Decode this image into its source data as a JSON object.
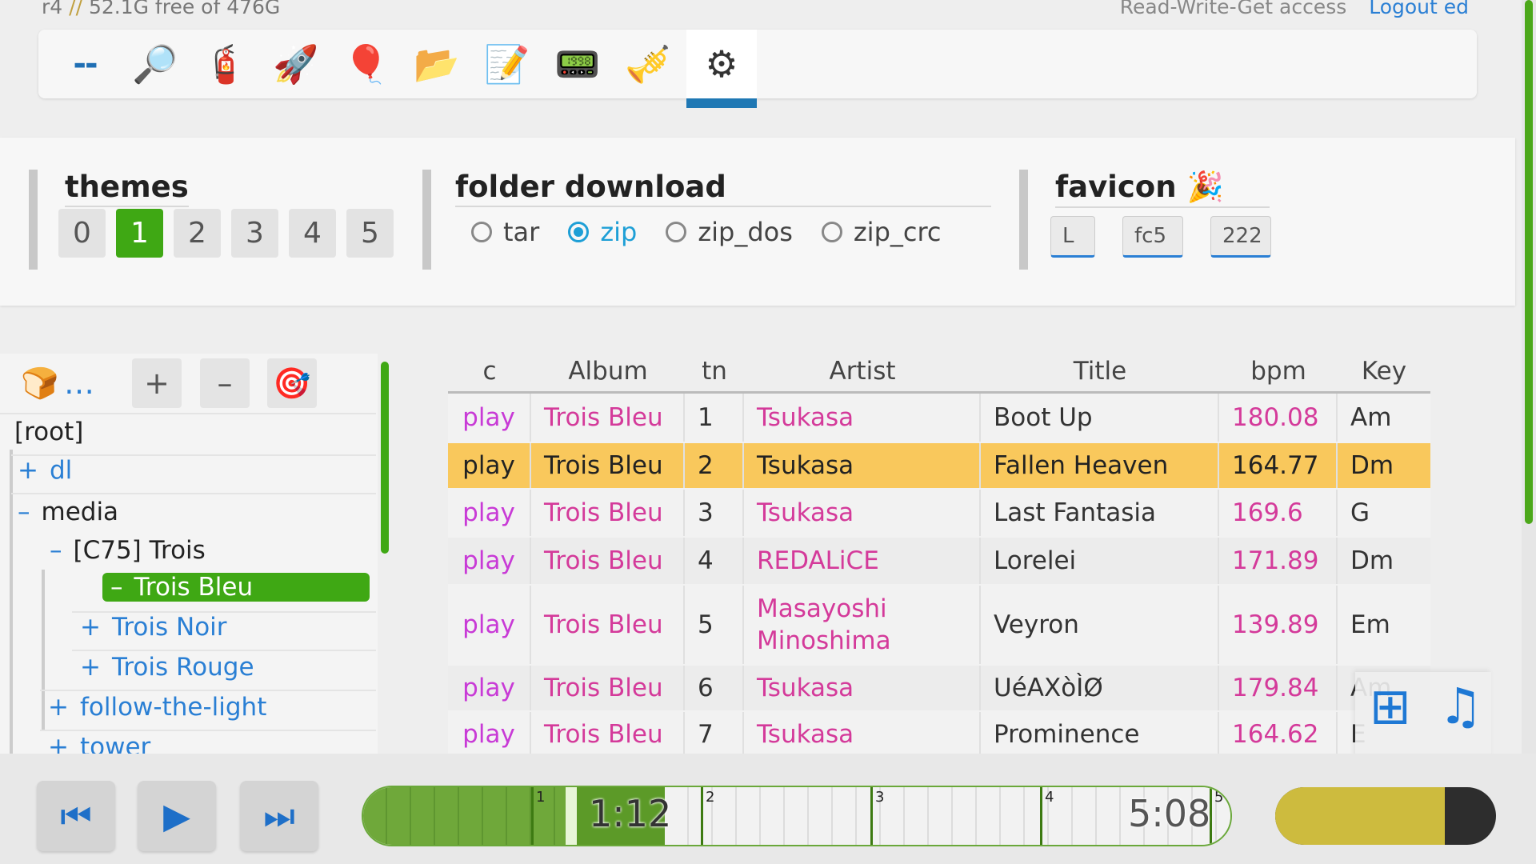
{
  "status": {
    "device": "r4",
    "separator": "//",
    "disk": "52.1G free of 476G"
  },
  "access": {
    "text": "Read-Write-Get access",
    "logout": "Logout ed"
  },
  "toolbar": {
    "buttons": [
      {
        "icon": "--"
      },
      {
        "icon": "🔎"
      },
      {
        "icon": "🧯"
      },
      {
        "icon": "🚀"
      },
      {
        "icon": "🎈"
      },
      {
        "icon": "📂"
      },
      {
        "icon": "📝"
      },
      {
        "icon": "📟"
      },
      {
        "icon": "🎺"
      },
      {
        "icon": "⚙"
      }
    ],
    "active_index": 9
  },
  "settings": {
    "themes": {
      "title": "themes",
      "options": [
        "0",
        "1",
        "2",
        "3",
        "4",
        "5"
      ],
      "selected": "1"
    },
    "folder_download": {
      "title": "folder download",
      "options": [
        "tar",
        "zip",
        "zip_dos",
        "zip_crc"
      ],
      "selected": "zip"
    },
    "favicon": {
      "title": "favicon 🎉",
      "inputs": [
        "L",
        "fc5",
        "222"
      ]
    }
  },
  "tree": {
    "toolbar": {
      "bread": "🍞",
      "ellipsis": "…",
      "plus": "+",
      "minus": "–",
      "target": "🎯"
    },
    "nodes": [
      {
        "label": "[root]"
      },
      {
        "sign": "+",
        "label": "dl"
      },
      {
        "sign": "–",
        "label": "media"
      },
      {
        "sign": "–",
        "label": "[C75] Trois"
      },
      {
        "sign": "–",
        "label": "Trois Bleu"
      },
      {
        "sign": "+",
        "label": "Trois Noir"
      },
      {
        "sign": "+",
        "label": "Trois Rouge"
      },
      {
        "sign": "+",
        "label": "follow-the-light"
      },
      {
        "sign": "+",
        "label": "tower"
      }
    ]
  },
  "table": {
    "headers": [
      "c",
      "Album",
      "tn",
      "Artist",
      "Title",
      "bpm",
      "Key"
    ],
    "rows": [
      {
        "c": "play",
        "album": "Trois Bleu",
        "tn": "1",
        "artist": "Tsukasa",
        "title": "Boot Up",
        "bpm": "180.08",
        "key": "Am"
      },
      {
        "c": "play",
        "album": "Trois Bleu",
        "tn": "2",
        "artist": "Tsukasa",
        "title": "Fallen Heaven",
        "bpm": "164.77",
        "key": "Dm"
      },
      {
        "c": "play",
        "album": "Trois Bleu",
        "tn": "3",
        "artist": "Tsukasa",
        "title": "Last Fantasia",
        "bpm": "169.6",
        "key": "G"
      },
      {
        "c": "play",
        "album": "Trois Bleu",
        "tn": "4",
        "artist": "REDALiCE",
        "title": "Lorelei",
        "bpm": "171.89",
        "key": "Dm"
      },
      {
        "c": "play",
        "album": "Trois Bleu",
        "tn": "5",
        "artist": "Masayoshi Minoshima",
        "title": "Veyron",
        "bpm": "139.89",
        "key": "Em"
      },
      {
        "c": "play",
        "album": "Trois Bleu",
        "tn": "6",
        "artist": "Tsukasa",
        "title": "UéAXòÌØ",
        "bpm": "179.84",
        "key": "Am"
      },
      {
        "c": "play",
        "album": "Trois Bleu",
        "tn": "7",
        "artist": "Tsukasa",
        "title": "Prominence",
        "bpm": "164.62",
        "key": "E"
      }
    ],
    "highlighted_row": 1
  },
  "floater": {
    "grid_icon": "⊞",
    "music_icon": "♫"
  },
  "player": {
    "prev_icon": "⏮",
    "play_icon": "▶",
    "next_icon": "⏭",
    "elapsed": "1:12",
    "duration": "5:08",
    "progress": 0.233,
    "markers": [
      "1",
      "2",
      "3",
      "4",
      "5"
    ],
    "volume": 0.78
  },
  "colors": {
    "accent_green": "#3fa814",
    "link_blue": "#2a7fd4",
    "highlight": "#f9c85c",
    "pink": "#d43a9a"
  }
}
